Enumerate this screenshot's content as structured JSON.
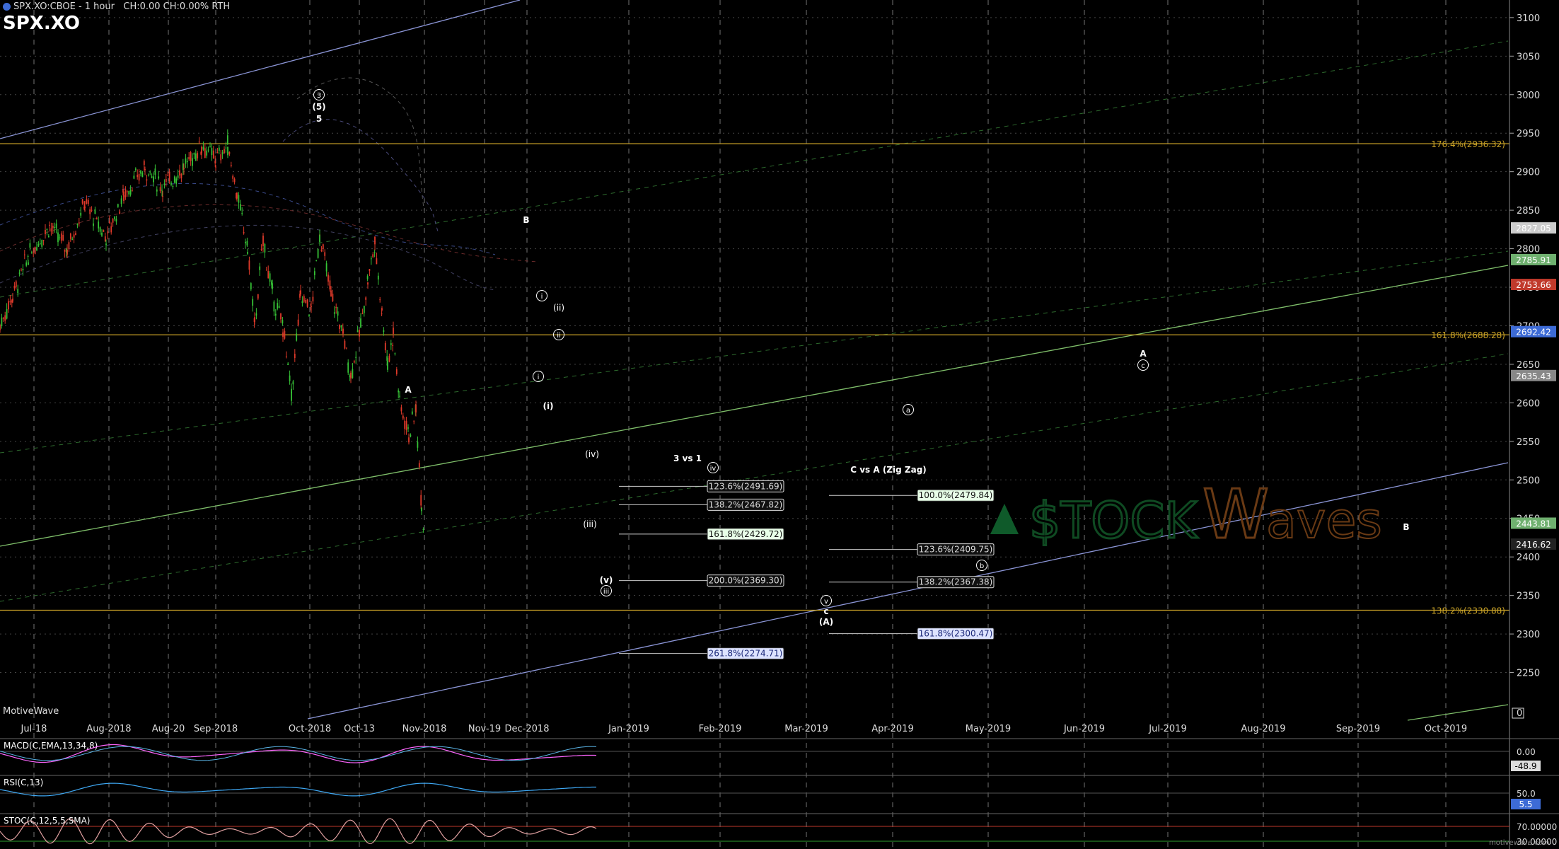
{
  "header": {
    "symbol": "SPX.XO:CBOE",
    "interval": "1 hour",
    "status": "CH:0.00 CH:0.00% RTH",
    "title": "SPX.XO",
    "brand": "MotiveWave",
    "watermark": "motivewave.com"
  },
  "colors": {
    "background": "#000000",
    "grid": "#9a9a9a",
    "fib_gold": "#c9a227",
    "trend_green": "#7fbf6a",
    "trend_blue": "#8b95d6",
    "up_candle": "#36c236",
    "down_candle": "#e03a2a",
    "macd": "#ff66ff",
    "rsi": "#3fa9f5",
    "stoch": "#e0a0a0"
  },
  "chart_data": {
    "type": "candlestick",
    "title": "SPX.XO",
    "xlabel": "",
    "ylabel": "",
    "ylim": [
      2200,
      3120
    ],
    "x_ticks": [
      "Jul-18",
      "Aug-2018",
      "Aug-20",
      "Sep-2018",
      "Oct-2018",
      "Oct-13",
      "Nov-2018",
      "Nov-19",
      "Dec-2018",
      "Jan-2019",
      "Feb-2019",
      "Mar-2019",
      "Apr-2019",
      "May-2019",
      "Jun-2019",
      "Jul-2019",
      "Aug-2019",
      "Sep-2019",
      "Oct-2019"
    ],
    "y_ticks": [
      3100,
      3050,
      3000,
      2950,
      2900,
      2850,
      2800,
      2750,
      2700,
      2650,
      2600,
      2550,
      2500,
      2450,
      2400,
      2350,
      2300,
      2250
    ],
    "y_zero_label": "0",
    "price_markers": [
      {
        "label": "2827.05",
        "value": 2827.05,
        "color": "#cccccc"
      },
      {
        "label": "2785.91",
        "value": 2785.91,
        "color": "#6fb06f"
      },
      {
        "label": "2753.66",
        "value": 2753.66,
        "color": "#c0392b"
      },
      {
        "label": "2692.42",
        "value": 2692.42,
        "color": "#3d6bd6"
      },
      {
        "label": "2635.43",
        "value": 2635.43,
        "color": "#888888"
      },
      {
        "label": "2443.81",
        "value": 2443.81,
        "color": "#6fb06f"
      },
      {
        "label": "2416.62",
        "value": 2416.62,
        "color": "#222222"
      }
    ],
    "fib_levels": [
      {
        "label": "176.4%(2936.32)",
        "value": 2936.32
      },
      {
        "label": "161.8%(2688.28)",
        "value": 2688.28
      },
      {
        "label": "138.2%(2330.88)",
        "value": 2330.88
      }
    ],
    "projection_groups": [
      {
        "title": "3 vs 1",
        "levels": [
          {
            "label": "123.6%(2491.69)",
            "value": 2491.69,
            "style": "dark"
          },
          {
            "label": "138.2%(2467.82)",
            "value": 2467.82,
            "style": "dark"
          },
          {
            "label": "161.8%(2429.72)",
            "value": 2429.72,
            "style": "green"
          },
          {
            "label": "200.0%(2369.30)",
            "value": 2369.3,
            "style": "dark"
          },
          {
            "label": "261.8%(2274.71)",
            "value": 2274.71,
            "style": "blue"
          }
        ]
      },
      {
        "title": "C vs A (Zig Zag)",
        "levels": [
          {
            "label": "100.0%(2479.84)",
            "value": 2479.84,
            "style": "green"
          },
          {
            "label": "123.6%(2409.75)",
            "value": 2409.75,
            "style": "dark"
          },
          {
            "label": "138.2%(2367.38)",
            "value": 2367.38,
            "style": "dark"
          },
          {
            "label": "161.8%(2300.47)",
            "value": 2300.47,
            "style": "blue"
          }
        ]
      }
    ],
    "wave_labels": [
      {
        "text": "3",
        "circled": true
      },
      {
        "text": "(5)"
      },
      {
        "text": "5"
      },
      {
        "text": "A"
      },
      {
        "text": "B"
      },
      {
        "text": "i",
        "circled": true
      },
      {
        "text": "ii",
        "circled": true
      },
      {
        "text": "(ii)"
      },
      {
        "text": "i",
        "circled": true
      },
      {
        "text": "(i)"
      },
      {
        "text": "(iv)"
      },
      {
        "text": "(iii)"
      },
      {
        "text": "(v)"
      },
      {
        "text": "iii",
        "circled": true
      },
      {
        "text": "iv",
        "circled": true
      },
      {
        "text": "v",
        "circled": true
      },
      {
        "text": "c"
      },
      {
        "text": "(A)"
      },
      {
        "text": "a",
        "circled": true
      },
      {
        "text": "b",
        "circled": true
      },
      {
        "text": "A"
      },
      {
        "text": "c",
        "circled": true
      },
      {
        "text": "B"
      }
    ],
    "series": [
      {
        "name": "SPX.XO",
        "points": [
          [
            0,
            2700
          ],
          [
            18,
            2740
          ],
          [
            40,
            2790
          ],
          [
            70,
            2830
          ],
          [
            95,
            2800
          ],
          [
            120,
            2860
          ],
          [
            150,
            2815
          ],
          [
            175,
            2870
          ],
          [
            205,
            2905
          ],
          [
            230,
            2880
          ],
          [
            260,
            2905
          ],
          [
            285,
            2935
          ],
          [
            305,
            2915
          ],
          [
            322,
            2935
          ],
          [
            335,
            2870
          ],
          [
            350,
            2800
          ],
          [
            360,
            2700
          ],
          [
            372,
            2810
          ],
          [
            385,
            2740
          ],
          [
            400,
            2700
          ],
          [
            412,
            2610
          ],
          [
            425,
            2740
          ],
          [
            440,
            2720
          ],
          [
            452,
            2820
          ],
          [
            468,
            2740
          ],
          [
            485,
            2690
          ],
          [
            496,
            2635
          ],
          [
            510,
            2700
          ],
          [
            520,
            2760
          ],
          [
            530,
            2805
          ],
          [
            540,
            2720
          ],
          [
            548,
            2650
          ],
          [
            556,
            2690
          ],
          [
            565,
            2600
          ],
          [
            578,
            2560
          ],
          [
            588,
            2590
          ],
          [
            596,
            2470
          ],
          [
            600,
            2420
          ]
        ]
      }
    ]
  },
  "indicators": [
    {
      "name": "MACD(C,EMA,13,34,8)",
      "ticks": [
        "0.00"
      ],
      "last": "-48.9"
    },
    {
      "name": "RSI(C,13)",
      "ticks": [
        "50.0"
      ],
      "last": "5.5"
    },
    {
      "name": "STOC(C,12,5,5,SMA)",
      "ticks": [
        "70.00000",
        "30.00000"
      ],
      "last": ""
    }
  ]
}
